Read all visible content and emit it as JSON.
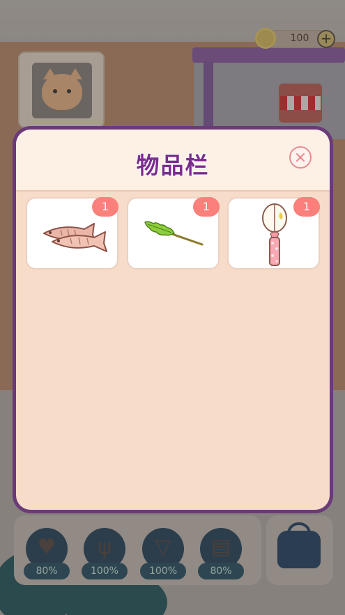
{
  "hud": {
    "coins": "100",
    "coin_plus": "+"
  },
  "inventory": {
    "title": "物品栏",
    "items": [
      {
        "icon": "dried-fish-icon",
        "count": "1"
      },
      {
        "icon": "feather-duster-icon",
        "count": "1"
      },
      {
        "icon": "bell-wand-icon",
        "count": "1"
      }
    ]
  },
  "stats": [
    {
      "icon": "heart-icon",
      "value": "80%"
    },
    {
      "icon": "fork-spoon-icon",
      "value": "100%"
    },
    {
      "icon": "cup-icon",
      "value": "100%"
    },
    {
      "icon": "brush-icon",
      "value": "80%"
    }
  ],
  "colors": {
    "modal_border": "#6b3a78",
    "modal_body": "#f7dcca",
    "title": "#7a2d8f",
    "badge": "#fb7f7b",
    "close": "#e98b92"
  }
}
